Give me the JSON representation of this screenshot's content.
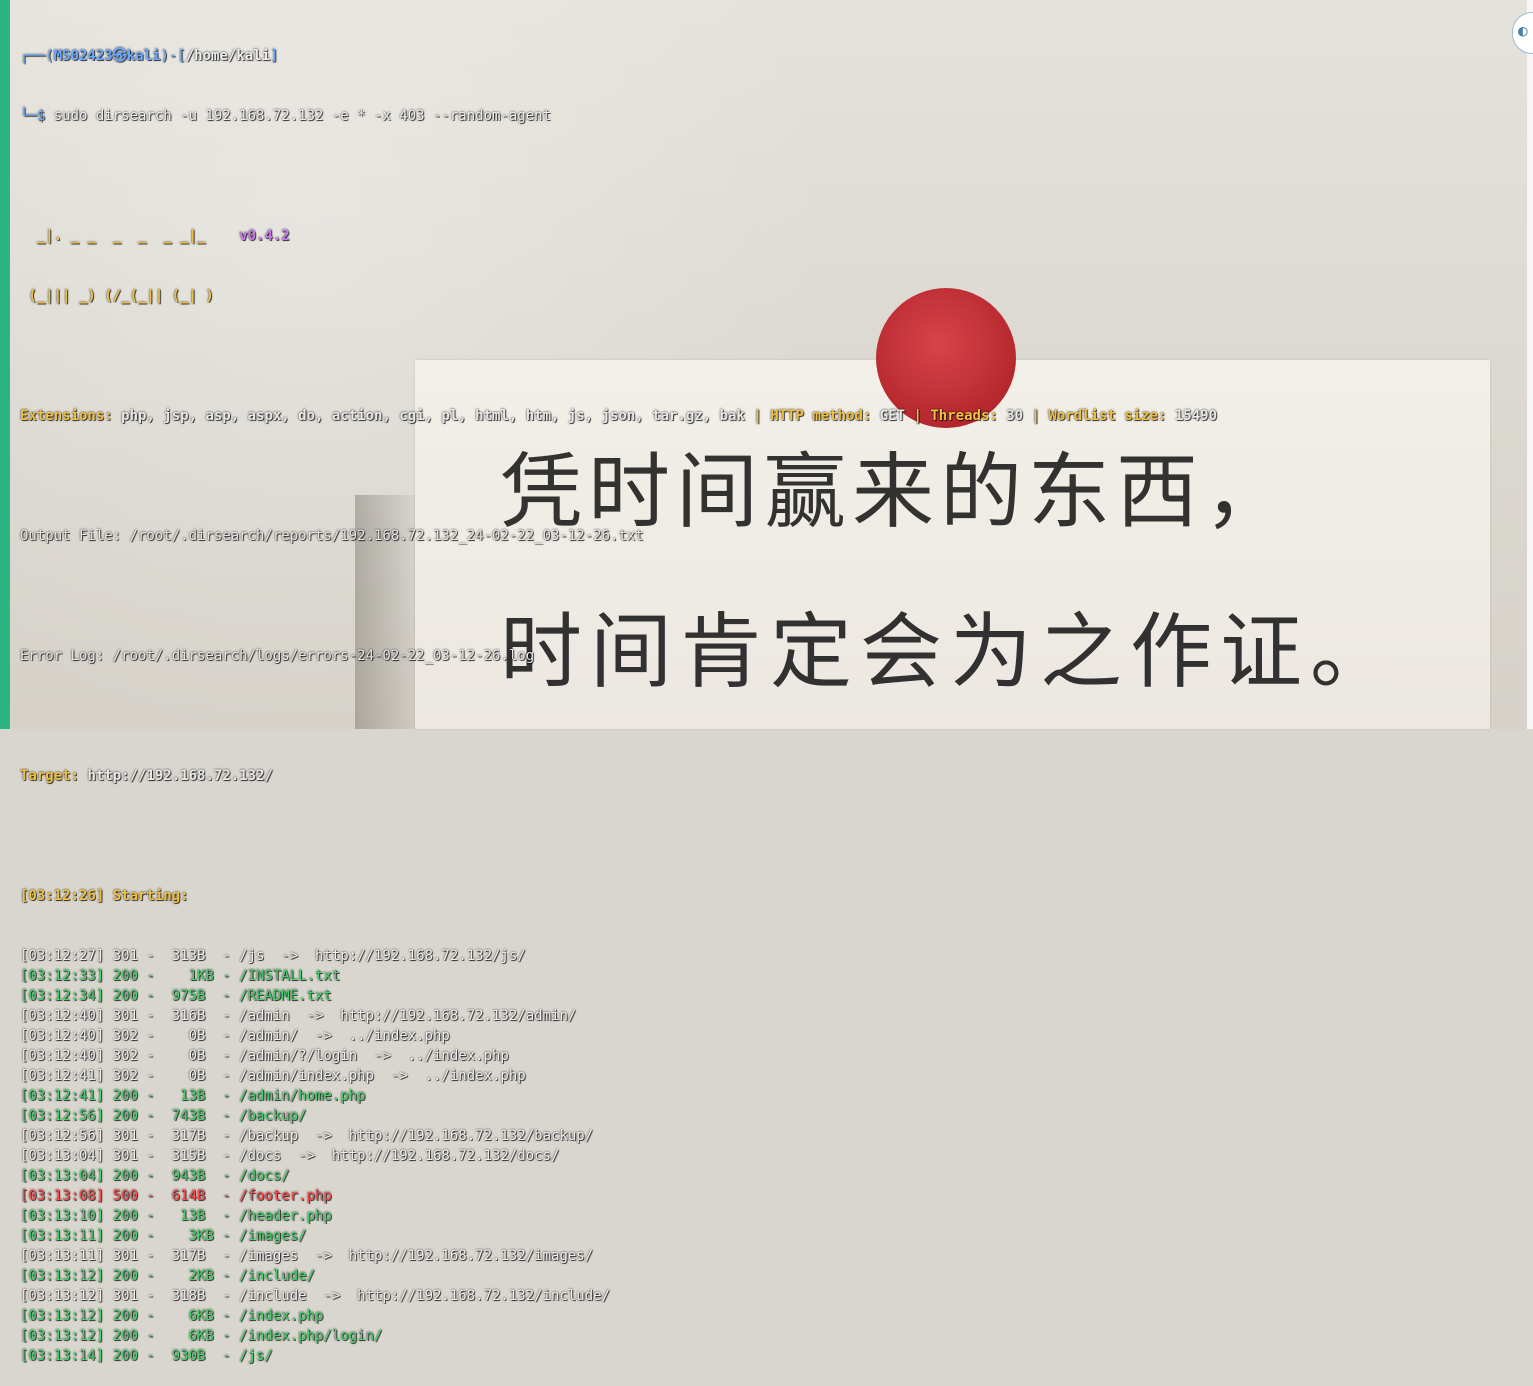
{
  "prompt": {
    "user": "MS02423",
    "host": "kali",
    "path": "/home/kali",
    "command": "sudo dirsearch -u 192.168.72.132 -e * -x 403 --random-agent"
  },
  "banner": {
    "art_line1": "  _|. _ _  _  _  _ _|_    ",
    "art_line2": " (_||| _) (/_(_|| (_| )",
    "version": "v0.4.2"
  },
  "config": {
    "extensions_label": "Extensions:",
    "extensions_value": "php, jsp, asp, aspx, do, action, cgi, pl, html, htm, js, json, tar.gz, bak",
    "method_label": "HTTP method:",
    "method_value": "GET",
    "threads_label": "Threads:",
    "threads_value": "30",
    "wordlist_label": "Wordlist size:",
    "wordlist_value": "15490"
  },
  "output_file": "Output File: /root/.dirsearch/reports/192.168.72.132_24-02-22_03-12-26.txt",
  "error_log": "Error Log: /root/.dirsearch/logs/errors-24-02-22_03-12-26.log",
  "target": {
    "label": "Target:",
    "url": "http://192.168.72.132/"
  },
  "starting": "[03:12:26] Starting:",
  "results": [
    {
      "line": "[03:12:27] 301 -  313B  - /js  ->  http://192.168.72.132/js/",
      "status": "301"
    },
    {
      "line": "[03:12:33] 200 -    1KB - /INSTALL.txt",
      "status": "200"
    },
    {
      "line": "[03:12:34] 200 -  975B  - /README.txt",
      "status": "200"
    },
    {
      "line": "[03:12:40] 301 -  316B  - /admin  ->  http://192.168.72.132/admin/",
      "status": "301"
    },
    {
      "line": "[03:12:40] 302 -    0B  - /admin/  ->  ../index.php",
      "status": "302"
    },
    {
      "line": "[03:12:40] 302 -    0B  - /admin/?/login  ->  ../index.php",
      "status": "302"
    },
    {
      "line": "[03:12:41] 302 -    0B  - /admin/index.php  ->  ../index.php",
      "status": "302"
    },
    {
      "line": "[03:12:41] 200 -   13B  - /admin/home.php",
      "status": "200"
    },
    {
      "line": "[03:12:56] 200 -  743B  - /backup/",
      "status": "200"
    },
    {
      "line": "[03:12:56] 301 -  317B  - /backup  ->  http://192.168.72.132/backup/",
      "status": "301"
    },
    {
      "line": "[03:13:04] 301 -  315B  - /docs  ->  http://192.168.72.132/docs/",
      "status": "301"
    },
    {
      "line": "[03:13:04] 200 -  943B  - /docs/",
      "status": "200"
    },
    {
      "line": "[03:13:08] 500 -  614B  - /footer.php",
      "status": "500"
    },
    {
      "line": "[03:13:10] 200 -   13B  - /header.php",
      "status": "200"
    },
    {
      "line": "[03:13:11] 200 -    3KB - /images/",
      "status": "200"
    },
    {
      "line": "[03:13:11] 301 -  317B  - /images  ->  http://192.168.72.132/images/",
      "status": "301"
    },
    {
      "line": "[03:13:12] 200 -    2KB - /include/",
      "status": "200"
    },
    {
      "line": "[03:13:12] 301 -  318B  - /include  ->  http://192.168.72.132/include/",
      "status": "301"
    },
    {
      "line": "[03:13:12] 200 -    6KB - /index.php",
      "status": "200"
    },
    {
      "line": "[03:13:12] 200 -    6KB - /index.php/login/",
      "status": "200"
    },
    {
      "line": "[03:13:14] 200 -  930B  - /js/",
      "status": "200"
    }
  ],
  "wallpaper_text": {
    "line1": "凭时间赢来的东西，",
    "line2": "时间肯定会为之作证。"
  },
  "colors": {
    "ok_200": "#47d16c",
    "error_500": "#ff4a4a",
    "label_yellow": "#f0c040",
    "prompt_blue": "#6aa9ff",
    "banner_purple": "#c67be8",
    "sun_red": "#c2323a"
  },
  "icons": {
    "corner": "app-launcher-icon"
  }
}
